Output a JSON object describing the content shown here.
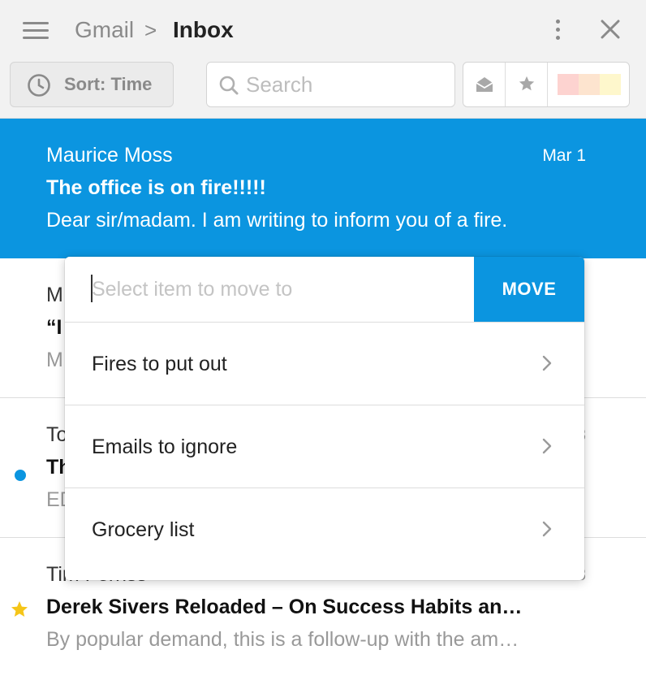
{
  "header": {
    "breadcrumb_root": "Gmail",
    "breadcrumb_separator": ">",
    "breadcrumb_current": "Inbox",
    "menu_icon": "hamburger-icon",
    "more_icon": "more-vertical-icon",
    "close_icon": "close-icon"
  },
  "toolbar": {
    "sort_label": "Sort: Time",
    "sort_icon": "clock-icon",
    "search_placeholder": "Search",
    "search_icon": "search-icon",
    "filters": [
      {
        "name": "read-filter",
        "icon": "open-envelope-icon"
      },
      {
        "name": "star-filter",
        "icon": "star-icon"
      }
    ],
    "label_swatches": [
      "#fdd3d0",
      "#fde4cf",
      "#fef7cc"
    ]
  },
  "emails": [
    {
      "sender": "Maurice Moss",
      "date": "Mar 1",
      "subject": "The office is on fire!!!!!",
      "preview": "Dear sir/madam. I am writing to inform you of a fire.",
      "selected": true
    },
    {
      "sender": "M",
      "date": "",
      "subject": "“I",
      "preview": "M"
    },
    {
      "sender": "To",
      "date": "3",
      "subject": "Th",
      "preview": "ED",
      "unread": true
    },
    {
      "sender": "Tim Ferriss",
      "date": "3",
      "subject": "Derek Sivers Reloaded – On Success Habits an…",
      "preview": "By popular demand, this is a follow-up with the am…",
      "starred": true
    }
  ],
  "move_popup": {
    "input_placeholder": "Select item to move to",
    "move_button_label": "MOVE",
    "options": [
      {
        "label": "Fires to put out"
      },
      {
        "label": "Emails to ignore"
      },
      {
        "label": "Grocery list"
      }
    ],
    "option_icon": "chevron-right-icon"
  },
  "colors": {
    "accent": "#0b95e0",
    "star": "#f5c518"
  }
}
